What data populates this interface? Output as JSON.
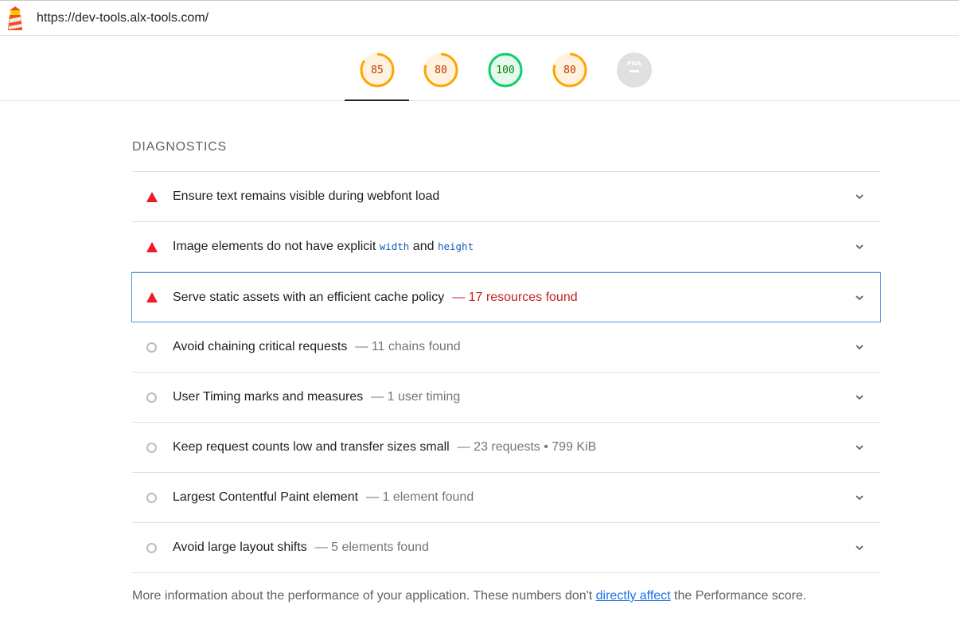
{
  "header": {
    "url": "https://dev-tools.alx-tools.com/"
  },
  "gauges": [
    {
      "value": "85",
      "score": 0.85,
      "status": "average",
      "color": "#ffa400",
      "text_color": "#c33300"
    },
    {
      "value": "80",
      "score": 0.8,
      "status": "average",
      "color": "#ffa400",
      "text_color": "#c33300"
    },
    {
      "value": "100",
      "score": 1.0,
      "status": "pass",
      "color": "#0cce6b",
      "text_color": "#008800"
    },
    {
      "value": "80",
      "score": 0.8,
      "status": "average",
      "color": "#ffa400",
      "text_color": "#c33300"
    },
    {
      "value": "PWA",
      "status": "na",
      "color": "#e0e0e0"
    }
  ],
  "diagnostics": {
    "title": "DIAGNOSTICS",
    "audits": [
      {
        "label": "Ensure text remains visible during webfont load",
        "display": "",
        "status": "fail"
      },
      {
        "label_parts": [
          "Image elements do not have explicit ",
          "width",
          " and ",
          "height"
        ],
        "display": "",
        "status": "fail"
      },
      {
        "label": "Serve static assets with an efficient cache policy",
        "display": "— 17 resources found",
        "status": "fail",
        "focused": true
      },
      {
        "label": "Avoid chaining critical requests",
        "display": "— 11 chains found",
        "status": "info"
      },
      {
        "label": "User Timing marks and measures",
        "display": "— 1 user timing",
        "status": "info"
      },
      {
        "label": "Keep request counts low and transfer sizes small",
        "display": "— 23 requests • 799 KiB",
        "status": "info"
      },
      {
        "label": "Largest Contentful Paint element",
        "display": "— 1 element found",
        "status": "info"
      },
      {
        "label": "Avoid large layout shifts",
        "display": "— 5 elements found",
        "status": "info"
      }
    ]
  },
  "footer": {
    "before": "More information about the performance of your application. These numbers don't ",
    "link": "directly affect",
    "after": " the Performance score."
  },
  "colors": {
    "fail": "#eb1c24",
    "average": "#ffa400",
    "pass": "#0cce6b",
    "link": "#1a73e8",
    "focus": "#4a90e2"
  },
  "icons": {
    "logo": "lighthouse-logo-icon",
    "expand": "chevron-down-icon",
    "fail": "red-triangle-icon",
    "info": "gray-circle-icon"
  }
}
